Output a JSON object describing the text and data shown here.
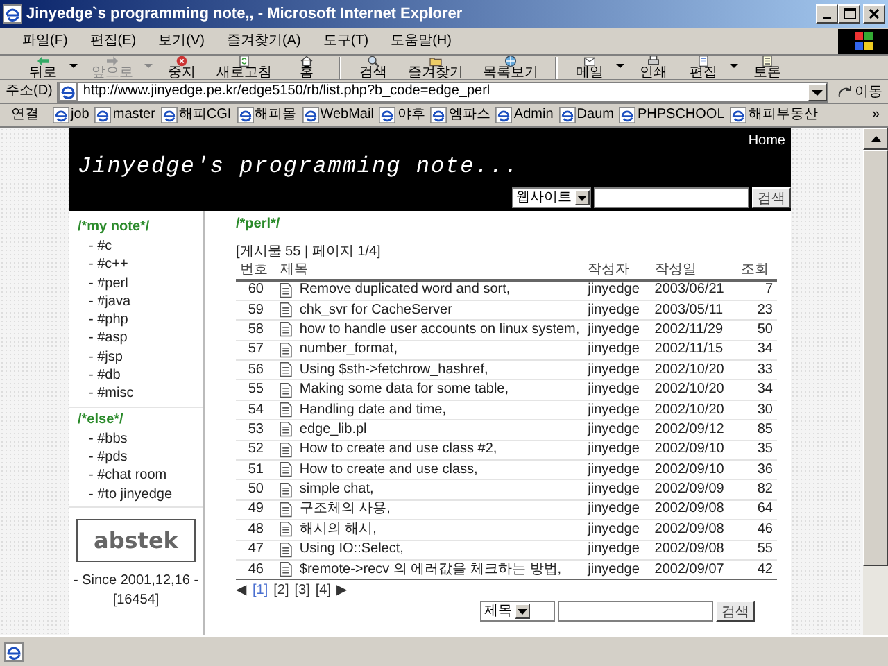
{
  "window": {
    "title": "Jinyedge`s programming note,, - Microsoft Internet Explorer"
  },
  "menu": [
    "파일(F)",
    "편집(E)",
    "보기(V)",
    "즐겨찾기(A)",
    "도구(T)",
    "도움말(H)"
  ],
  "toolbar": [
    {
      "label": "뒤로",
      "disabled": false,
      "dropdown": true
    },
    {
      "label": "앞으로",
      "disabled": true,
      "dropdown": true
    },
    {
      "label": "중지",
      "disabled": false,
      "dropdown": false
    },
    {
      "label": "새로고침",
      "disabled": false,
      "dropdown": false
    },
    {
      "label": "홈",
      "disabled": false,
      "dropdown": false
    },
    {
      "label": "검색",
      "disabled": false,
      "dropdown": false
    },
    {
      "label": "즐겨찾기",
      "disabled": false,
      "dropdown": false
    },
    {
      "label": "목록보기",
      "disabled": false,
      "dropdown": false
    },
    {
      "label": "메일",
      "disabled": false,
      "dropdown": true
    },
    {
      "label": "인쇄",
      "disabled": false,
      "dropdown": false
    },
    {
      "label": "편집",
      "disabled": false,
      "dropdown": true
    },
    {
      "label": "토론",
      "disabled": false,
      "dropdown": false
    }
  ],
  "address": {
    "label": "주소(D)",
    "url": "http://www.jinyedge.pe.kr/edge5150/rb/list.php?b_code=edge_perl",
    "go": "이동"
  },
  "links": {
    "label": "연결",
    "items": [
      "job",
      "master",
      "해피CGI",
      "해피몰",
      "WebMail",
      "야후",
      "엠파스",
      "Admin",
      "Daum",
      "PHPSCHOOL",
      "해피부동산"
    ],
    "more": "»"
  },
  "site": {
    "home": "Home",
    "title": "Jinyedge's programming note...",
    "search": {
      "scope": "웹사이트",
      "button": "검색"
    }
  },
  "sidebar": {
    "sections": [
      {
        "heading": "/*my note*/",
        "items": [
          "- #c",
          "- #c++",
          "- #perl",
          "- #java",
          "- #php",
          "- #asp",
          "- #jsp",
          "- #db",
          "- #misc"
        ]
      },
      {
        "heading": "/*else*/",
        "items": [
          "- #bbs",
          "- #pds",
          "- #chat room",
          "- #to jinyedge"
        ]
      }
    ],
    "logo": "abstek",
    "since": "- Since 2001,12,16 -",
    "counter": "[16454]"
  },
  "board": {
    "title": "/*perl*/",
    "info": "[게시물 55 | 페이지 1/4]",
    "columns": [
      "번호",
      "제목",
      "작성자",
      "작성일",
      "조회"
    ],
    "rows": [
      {
        "no": "60",
        "title": "Remove duplicated word and sort,",
        "author": "jinyedge",
        "date": "2003/06/21",
        "hits": "7"
      },
      {
        "no": "59",
        "title": "chk_svr for CacheServer",
        "author": "jinyedge",
        "date": "2003/05/11",
        "hits": "23"
      },
      {
        "no": "58",
        "title": "how to handle user accounts on linux system,",
        "author": "jinyedge",
        "date": "2002/11/29",
        "hits": "50"
      },
      {
        "no": "57",
        "title": "number_format,",
        "author": "jinyedge",
        "date": "2002/11/15",
        "hits": "34"
      },
      {
        "no": "56",
        "title": "Using $sth->fetchrow_hashref,",
        "author": "jinyedge",
        "date": "2002/10/20",
        "hits": "33"
      },
      {
        "no": "55",
        "title": "Making some data for some table,",
        "author": "jinyedge",
        "date": "2002/10/20",
        "hits": "34"
      },
      {
        "no": "54",
        "title": "Handling date and time,",
        "author": "jinyedge",
        "date": "2002/10/20",
        "hits": "30"
      },
      {
        "no": "53",
        "title": "edge_lib.pl",
        "author": "jinyedge",
        "date": "2002/09/12",
        "hits": "85"
      },
      {
        "no": "52",
        "title": "How to create and use class #2,",
        "author": "jinyedge",
        "date": "2002/09/10",
        "hits": "35"
      },
      {
        "no": "51",
        "title": "How to create and use class,",
        "author": "jinyedge",
        "date": "2002/09/10",
        "hits": "36"
      },
      {
        "no": "50",
        "title": "simple chat,",
        "author": "jinyedge",
        "date": "2002/09/09",
        "hits": "82"
      },
      {
        "no": "49",
        "title": "구조체의 사용,",
        "author": "jinyedge",
        "date": "2002/09/08",
        "hits": "64"
      },
      {
        "no": "48",
        "title": "해시의 해시,",
        "author": "jinyedge",
        "date": "2002/09/08",
        "hits": "46"
      },
      {
        "no": "47",
        "title": "Using IO::Select,",
        "author": "jinyedge",
        "date": "2002/09/08",
        "hits": "55"
      },
      {
        "no": "46",
        "title": "$remote->recv 의 에러값을 체크하는 방법,",
        "author": "jinyedge",
        "date": "2002/09/07",
        "hits": "42"
      }
    ],
    "pagination": {
      "prev": "◀",
      "pages": [
        {
          "label": "[1]",
          "selected": true
        },
        {
          "label": "[2]",
          "selected": false
        },
        {
          "label": "[3]",
          "selected": false
        },
        {
          "label": "[4]",
          "selected": false
        }
      ],
      "next": "▶"
    },
    "search": {
      "field": "제목",
      "button": "검색"
    }
  }
}
